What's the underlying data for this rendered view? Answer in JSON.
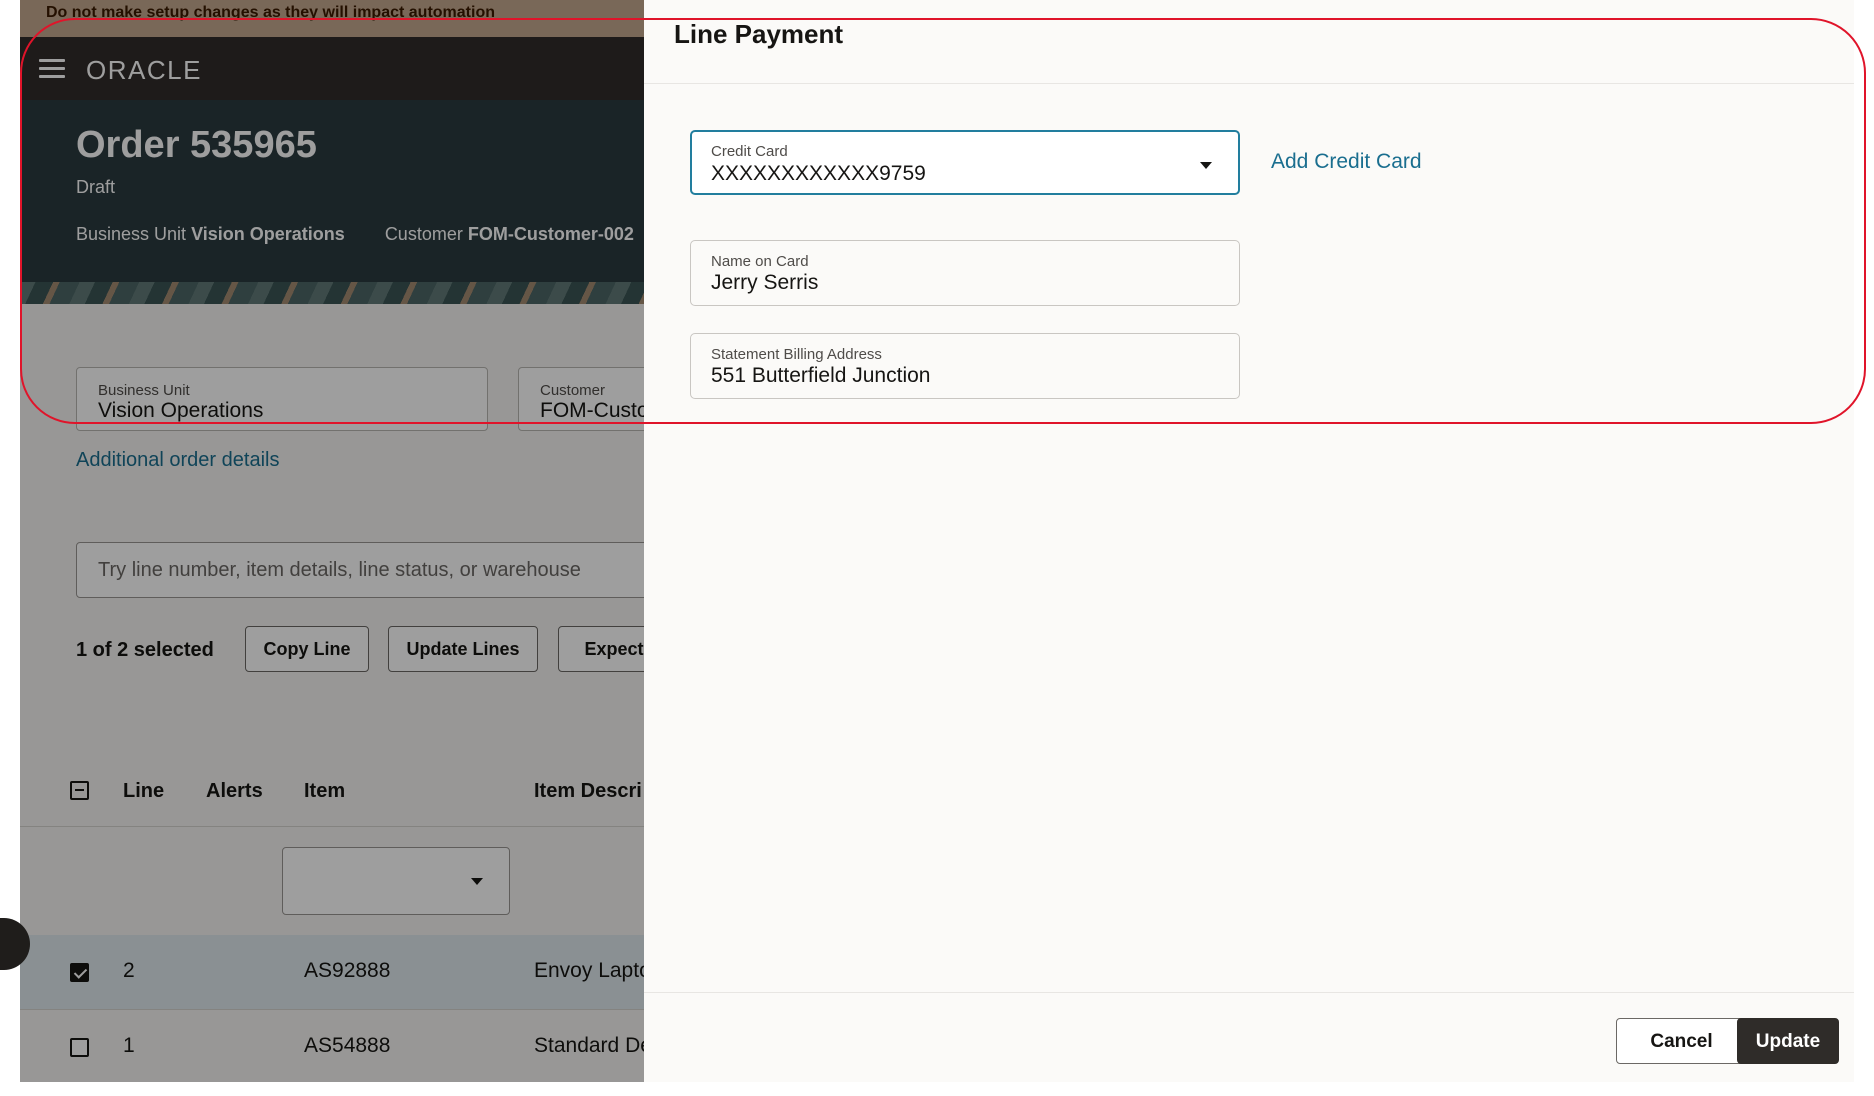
{
  "banner": {
    "text": "Do not make setup changes as they will impact automation"
  },
  "topbar": {
    "brand": "ORACLE",
    "menu_icon": "hamburger-icon"
  },
  "order": {
    "title": "Order 535965",
    "status": "Draft",
    "business_unit_label": "Business Unit",
    "business_unit_value": "Vision Operations",
    "customer_label": "Customer",
    "customer_value": "FOM-Customer-002"
  },
  "form": {
    "business_unit": {
      "label": "Business Unit",
      "value": "Vision Operations"
    },
    "customer": {
      "label": "Customer",
      "value": "FOM-Custo"
    },
    "additional_link": "Additional order details"
  },
  "lines": {
    "search_placeholder": "Try line number, item details, line status, or warehouse",
    "selected_text": "1 of 2 selected",
    "buttons": [
      "Copy Line",
      "Update Lines",
      "Expecte"
    ],
    "columns": [
      "Line",
      "Alerts",
      "Item",
      "Item Descri"
    ],
    "rows": [
      {
        "line": "2",
        "item": "AS92888",
        "description": "Envoy Lapto",
        "checked": true
      },
      {
        "line": "1",
        "item": "AS54888",
        "description": "Standard De",
        "checked": false
      }
    ]
  },
  "drawer": {
    "title": "Line Payment",
    "credit_card": {
      "label": "Credit Card",
      "value": "XXXXXXXXXXXX9759"
    },
    "add_credit_card": "Add Credit Card",
    "name_on_card": {
      "label": "Name on Card",
      "value": "Jerry Serris"
    },
    "billing_address": {
      "label": "Statement Billing Address",
      "value": "551 Butterfield Junction"
    },
    "cancel_label": "Cancel",
    "update_label": "Update"
  },
  "colors": {
    "accent": "#227e9e",
    "link": "#1a6e8f",
    "highlight": "#e0142a",
    "primary_button": "#2f2c29"
  }
}
